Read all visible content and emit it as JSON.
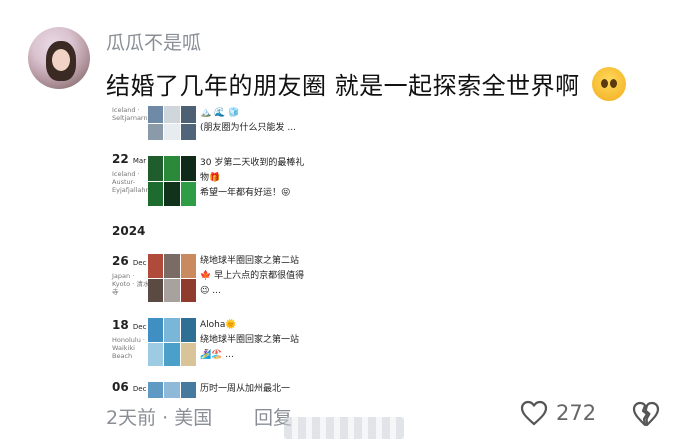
{
  "comment": {
    "username": "瓜瓜不是呱",
    "text": "结婚了几年的朋友圈 就是一起探索全世界啊",
    "emoji": "crying-face-emoji",
    "time_location": "2天前 · 美国",
    "reply_label": "回复",
    "like_count": "272"
  },
  "screenshot": {
    "year_label": "2024",
    "entries": [
      {
        "day": "",
        "month": "",
        "location": "Iceland · Seltjarnarnes",
        "text": "🏔️ 🌊 🧊\n(朋友圈为什么只能发 ..."
      },
      {
        "day": "22",
        "month": "Mar",
        "location": "Iceland · Austur-Eyjafjallahr...",
        "text": "30 岁第二天收到的最棒礼物🎁\n希望一年都有好运！😝"
      },
      {
        "day": "26",
        "month": "Dec",
        "location": "Japan · Kyoto · 清水寺",
        "text": "绕地球半圈回家之第二站🍁 早上六点的京都很值得😉 ..."
      },
      {
        "day": "18",
        "month": "Dec",
        "location": "Honolulu · Waikiki Beach",
        "text": "Aloha🌞\n绕地球半圈回家之第一站🏄‍♀️🏖️ ..."
      },
      {
        "day": "06",
        "month": "Dec",
        "location": "",
        "text": "历时一周从加州最北一"
      }
    ]
  },
  "colors": {
    "meta_gray": "#8a8f96",
    "text_dark": "#111111",
    "aurora_green": "#2a8a3a"
  }
}
